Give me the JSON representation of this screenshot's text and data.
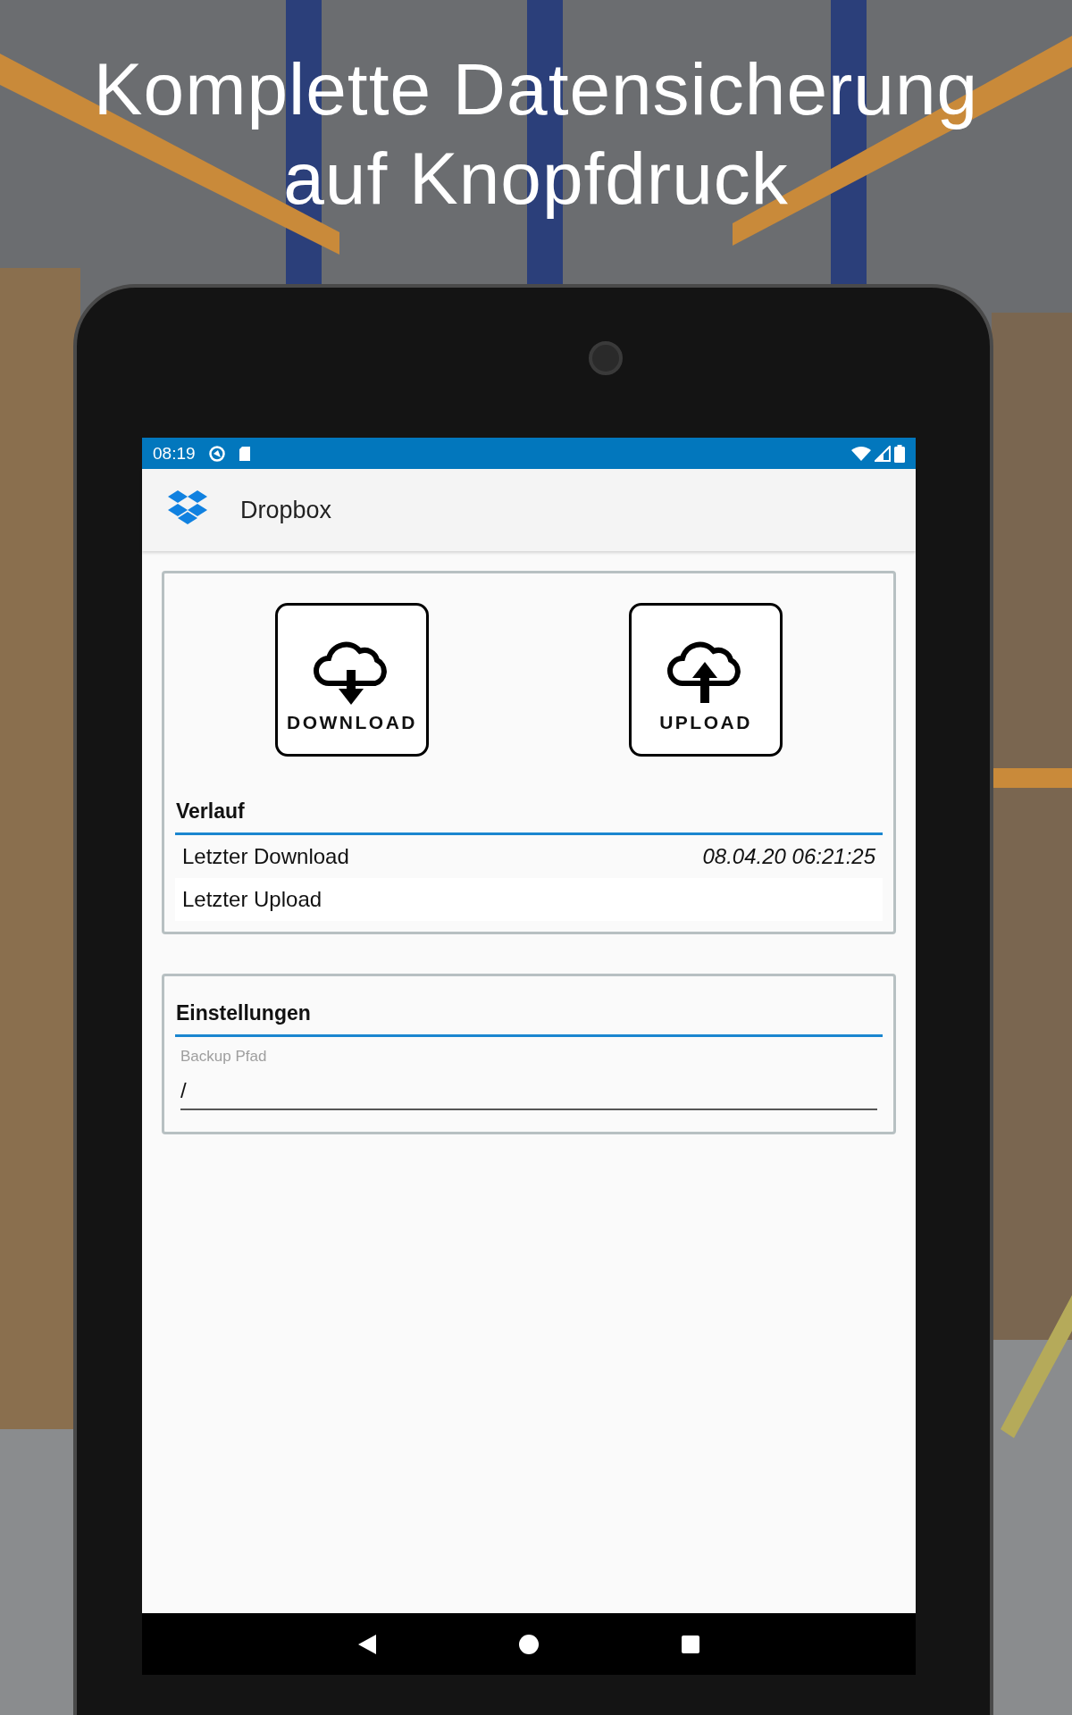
{
  "headline": {
    "lines": [
      "Komplette Datensicherung",
      "auf Knopfdruck"
    ]
  },
  "status_bar": {
    "time": "08:19"
  },
  "app_bar": {
    "title": "Dropbox"
  },
  "actions": [
    {
      "kind": "download",
      "label": "DOWNLOAD"
    },
    {
      "kind": "upload",
      "label": "UPLOAD"
    }
  ],
  "history": {
    "title": "Verlauf",
    "rows": [
      {
        "label": "Letzter Download",
        "value": "08.04.20 06:21:25"
      },
      {
        "label": "Letzter Upload"
      }
    ]
  },
  "settings": {
    "title": "Einstellungen",
    "fields": [
      {
        "label": "Backup Pfad",
        "value": "/"
      }
    ]
  }
}
